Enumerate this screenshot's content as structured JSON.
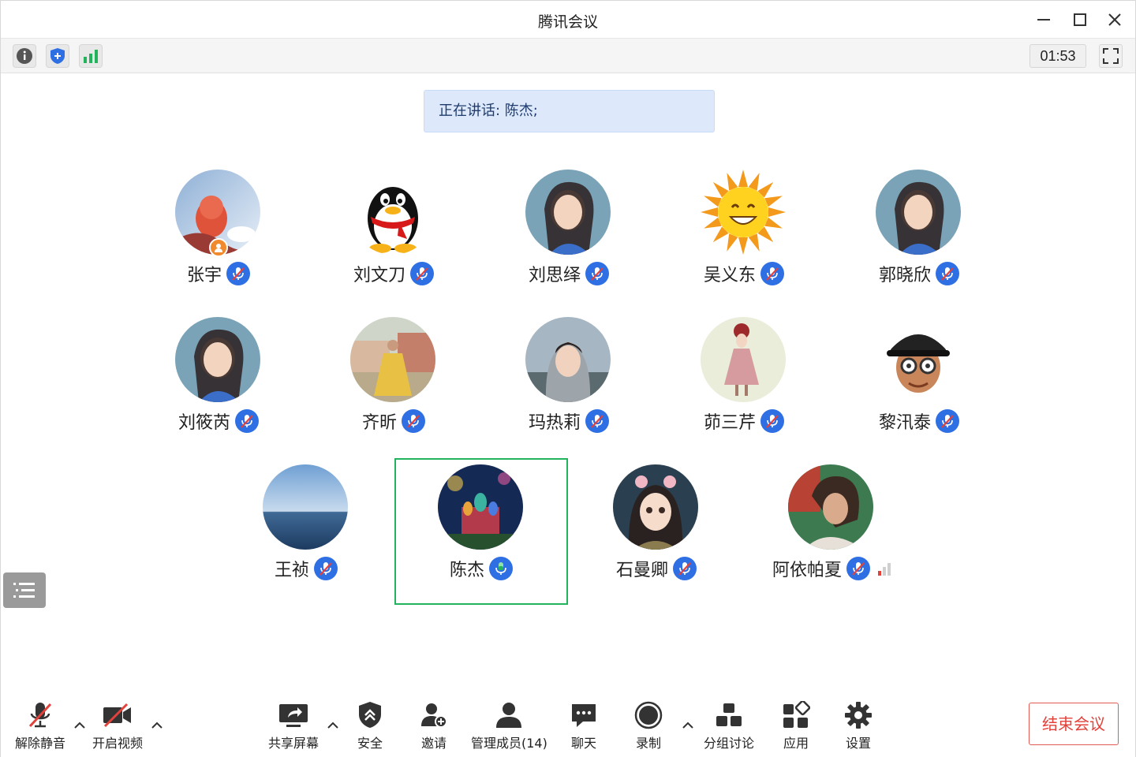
{
  "window": {
    "title": "腾讯会议"
  },
  "toolbar": {
    "timer": "01:53"
  },
  "speaking": {
    "text": "正在讲话: 陈杰;"
  },
  "participants": [
    {
      "name": "张宇",
      "mic": "muted",
      "host": true,
      "avatar": "fox-cartoon"
    },
    {
      "name": "刘文刀",
      "mic": "muted",
      "avatar": "qq-penguin"
    },
    {
      "name": "刘思绎",
      "mic": "muted",
      "avatar": "girl-portrait"
    },
    {
      "name": "吴义东",
      "mic": "muted",
      "avatar": "smiling-sun"
    },
    {
      "name": "郭晓欣",
      "mic": "muted",
      "avatar": "girl-portrait"
    },
    {
      "name": "刘筱芮",
      "mic": "muted",
      "avatar": "girl-portrait"
    },
    {
      "name": "齐昕",
      "mic": "muted",
      "avatar": "girl-yellow-dress"
    },
    {
      "name": "玛热莉",
      "mic": "muted",
      "avatar": "girl-hood"
    },
    {
      "name": "茆三芹",
      "mic": "muted",
      "avatar": "girl-illustration"
    },
    {
      "name": "黎汛泰",
      "mic": "muted",
      "avatar": "memoji"
    },
    {
      "name": "王祯",
      "mic": "muted",
      "avatar": "sea-horizon"
    },
    {
      "name": "陈杰",
      "mic": "speaking",
      "active": true,
      "avatar": "castle-night"
    },
    {
      "name": "石曼卿",
      "mic": "muted",
      "avatar": "anime-girl"
    },
    {
      "name": "阿依帕夏",
      "mic": "muted",
      "weak_signal": true,
      "avatar": "woman-portrait"
    }
  ],
  "bottom": {
    "unmute": "解除静音",
    "video": "开启视频",
    "share": "共享屏幕",
    "security": "安全",
    "invite": "邀请",
    "members": "管理成员(14)",
    "chat": "聊天",
    "record": "录制",
    "breakout": "分组讨论",
    "apps": "应用",
    "settings": "设置",
    "end": "结束会议"
  },
  "colors": {
    "accent": "#2f6fe4",
    "active_border": "#22b35c",
    "end": "#e2423b",
    "banner": "#dde9fb"
  }
}
